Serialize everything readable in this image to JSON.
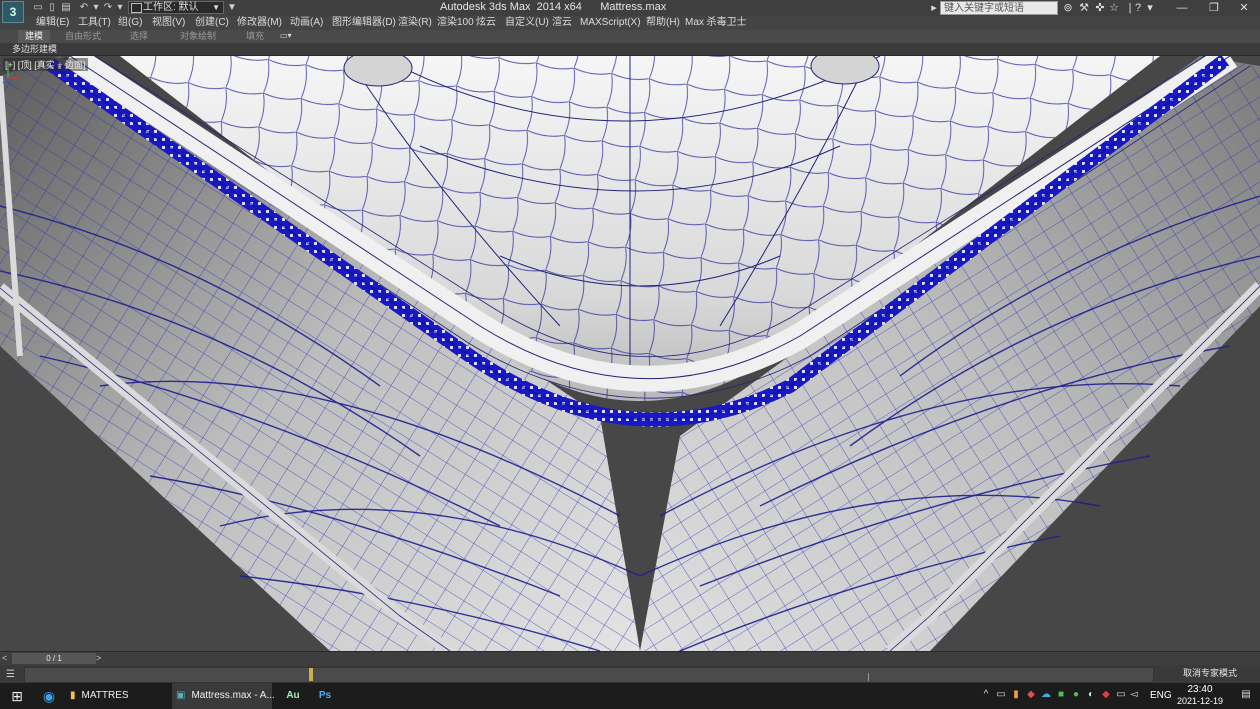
{
  "title_bar": {
    "app_logo": "3",
    "workspace_label": "工作区: 默认",
    "title": "Autodesk 3ds Max  2014 x64      Mattress.max",
    "search_placeholder": "键入关键字或短语",
    "window_controls": [
      "minimize-icon",
      "maximize-icon",
      "close-icon"
    ]
  },
  "menu": {
    "items": [
      "编辑(E)",
      "工具(T)",
      "组(G)",
      "视图(V)",
      "创建(C)",
      "修改器(M)",
      "动画(A)",
      "图形编辑器(D)",
      "渲染(R)",
      "渲染100",
      "炫云",
      "自定义(U)",
      "渲云",
      "MAXScript(X)",
      "帮助(H)",
      "Max 杀毒卫士"
    ]
  },
  "ribbon": {
    "tabs": [
      "建模",
      "自由形式",
      "选择",
      "对象绘制",
      "填充"
    ],
    "active_tab": 0,
    "sub_label": "多边形建模"
  },
  "viewport": {
    "label": "[+] [顶] [真实 + 边面]",
    "wire_color": "#1f1fb4",
    "surface_color": "#e6e6e6",
    "background": "#474747"
  },
  "time_slider": {
    "frame": "0 / 1",
    "prev": "<",
    "next": ">"
  },
  "track_bar": {
    "status": "取消专家模式"
  },
  "taskbar": {
    "items": [
      {
        "icon": "windows-start-icon",
        "label": ""
      },
      {
        "icon": "edge-icon",
        "label": ""
      },
      {
        "icon": "folder-icon",
        "label": "MATTRES"
      },
      {
        "icon": "3dsmax-icon",
        "label": "Mattress.max - A..."
      },
      {
        "icon": "audition-icon",
        "label": "Au"
      },
      {
        "icon": "photoshop-icon",
        "label": "Ps"
      }
    ],
    "language": "ENG",
    "time": "23:40",
    "date": "2021-12-19"
  }
}
